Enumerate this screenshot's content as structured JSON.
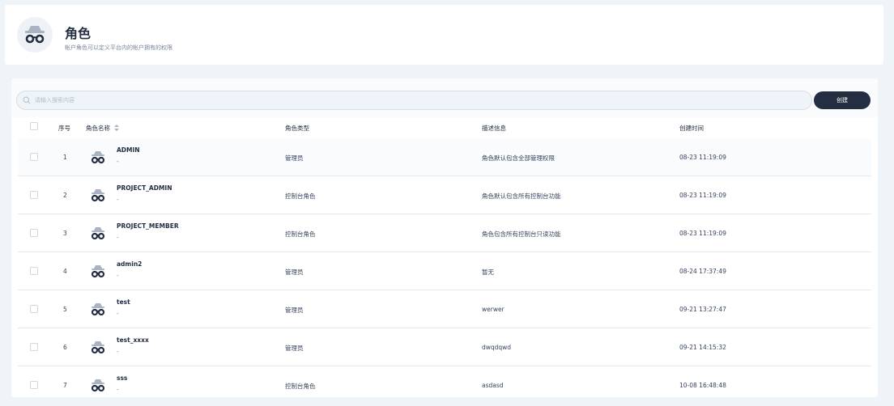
{
  "header": {
    "title": "角色",
    "description": "帐户角色可以定义平台内的帐户拥有的权限"
  },
  "toolbar": {
    "search_placeholder": "请输入搜索内容",
    "create_label": "创建"
  },
  "table": {
    "columns": {
      "index": "序号",
      "name": "角色名称",
      "type": "角色类型",
      "description": "描述信息",
      "created": "创建时间"
    },
    "rows": [
      {
        "index": "1",
        "name": "ADMIN",
        "sub": "-",
        "type": "管理员",
        "description": "角色默认包含全部管理权限",
        "created": "08-23 11:19:09"
      },
      {
        "index": "2",
        "name": "PROJECT_ADMIN",
        "sub": "-",
        "type": "控制台角色",
        "description": "角色默认包含所有控制台功能",
        "created": "08-23 11:19:09"
      },
      {
        "index": "3",
        "name": "PROJECT_MEMBER",
        "sub": "-",
        "type": "控制台角色",
        "description": "角色包含所有控制台只读功能",
        "created": "08-23 11:19:09"
      },
      {
        "index": "4",
        "name": "admin2",
        "sub": "-",
        "type": "管理员",
        "description": "暂无",
        "created": "08-24 17:37:49"
      },
      {
        "index": "5",
        "name": "test",
        "sub": "-",
        "type": "管理员",
        "description": "werwer",
        "created": "09-21 13:27:47"
      },
      {
        "index": "6",
        "name": "test_xxxx",
        "sub": "-",
        "type": "管理员",
        "description": "dwqdqwd",
        "created": "09-21 14:15:32"
      },
      {
        "index": "7",
        "name": "sss",
        "sub": "-",
        "type": "控制台角色",
        "description": "asdasd",
        "created": "10-08 16:48:48"
      }
    ]
  },
  "icons": {
    "header": "role-incognito-icon",
    "row_avatar": "role-incognito-icon",
    "search": "search-icon",
    "sort": "sort-icon"
  },
  "colors": {
    "accent": "#242e42",
    "background": "#eff4f9",
    "muted_text": "#79879c"
  }
}
